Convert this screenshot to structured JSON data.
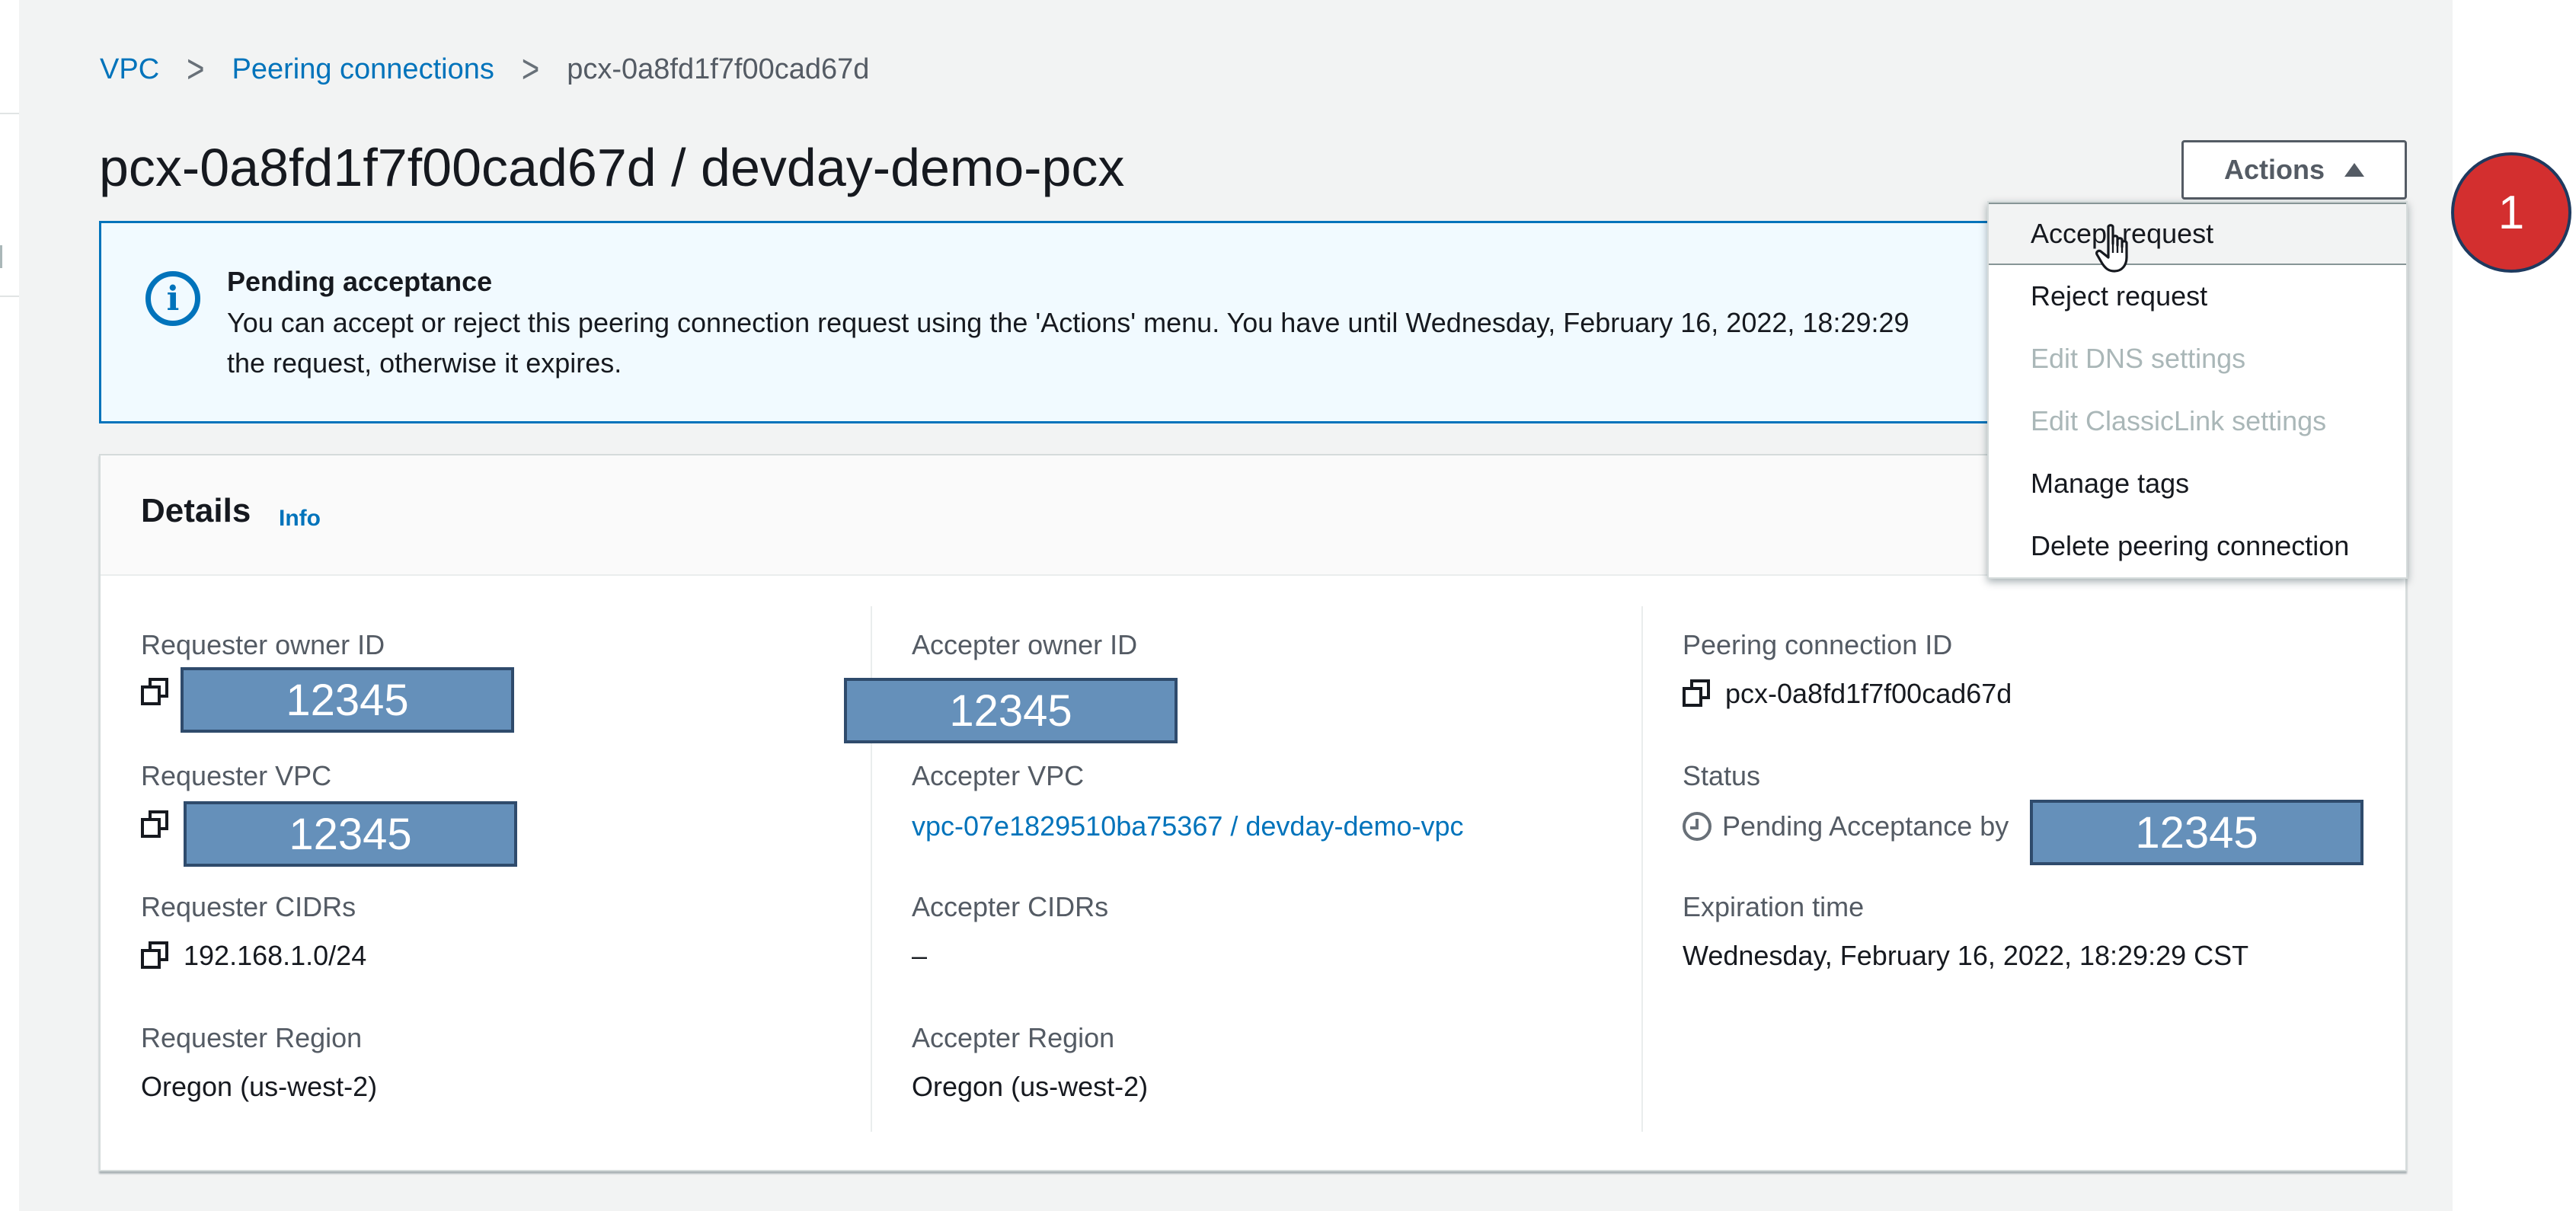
{
  "breadcrumb": {
    "vpc": "VPC",
    "peering_connections": "Peering connections",
    "current": "pcx-0a8fd1f7f00cad67d",
    "separator": ">"
  },
  "page": {
    "title": "pcx-0a8fd1f7f00cad67d / devday-demo-pcx"
  },
  "actions": {
    "label": "Actions",
    "menu": [
      {
        "label": "Accept request",
        "enabled": true,
        "hovered": true
      },
      {
        "label": "Reject request",
        "enabled": true
      },
      {
        "label": "Edit DNS settings",
        "enabled": false
      },
      {
        "label": "Edit ClassicLink settings",
        "enabled": false
      },
      {
        "label": "Manage tags",
        "enabled": true
      },
      {
        "label": "Delete peering connection",
        "enabled": true
      }
    ]
  },
  "alert": {
    "title": "Pending acceptance",
    "line1": "You can accept or reject this peering connection request using the 'Actions' menu. You have until Wednesday, February 16, 2022, 18:29:29",
    "line2": "the request, otherwise it expires.",
    "icon": "info-icon",
    "accent_color": "#0073bb"
  },
  "details": {
    "title": "Details",
    "info_link": "Info",
    "requester_owner_id": {
      "label": "Requester owner ID",
      "value": "12345"
    },
    "requester_vpc": {
      "label": "Requester VPC",
      "value": "12345"
    },
    "requester_cidrs": {
      "label": "Requester CIDRs",
      "value": "192.168.1.0/24"
    },
    "requester_region": {
      "label": "Requester Region",
      "value": "Oregon (us-west-2)"
    },
    "accepter_owner_id": {
      "label": "Accepter owner ID",
      "value": "12345"
    },
    "accepter_vpc": {
      "label": "Accepter VPC",
      "value": "vpc-07e1829510ba75367 / devday-demo-vpc"
    },
    "accepter_cidrs": {
      "label": "Accepter CIDRs",
      "value": "–"
    },
    "accepter_region": {
      "label": "Accepter Region",
      "value": "Oregon (us-west-2)"
    },
    "peering_connection_id": {
      "label": "Peering connection ID",
      "value": "pcx-0a8fd1f7f00cad67d"
    },
    "status": {
      "label": "Status",
      "value": "Pending Acceptance by",
      "account": "12345"
    },
    "expiration_time": {
      "label": "Expiration time",
      "value": "Wednesday, February 16, 2022, 18:29:29 CST"
    }
  },
  "annotation": {
    "step_number": "1",
    "badge_color": "#d32f2f"
  },
  "colors": {
    "link": "#0073bb",
    "redaction": "#6590ba"
  }
}
